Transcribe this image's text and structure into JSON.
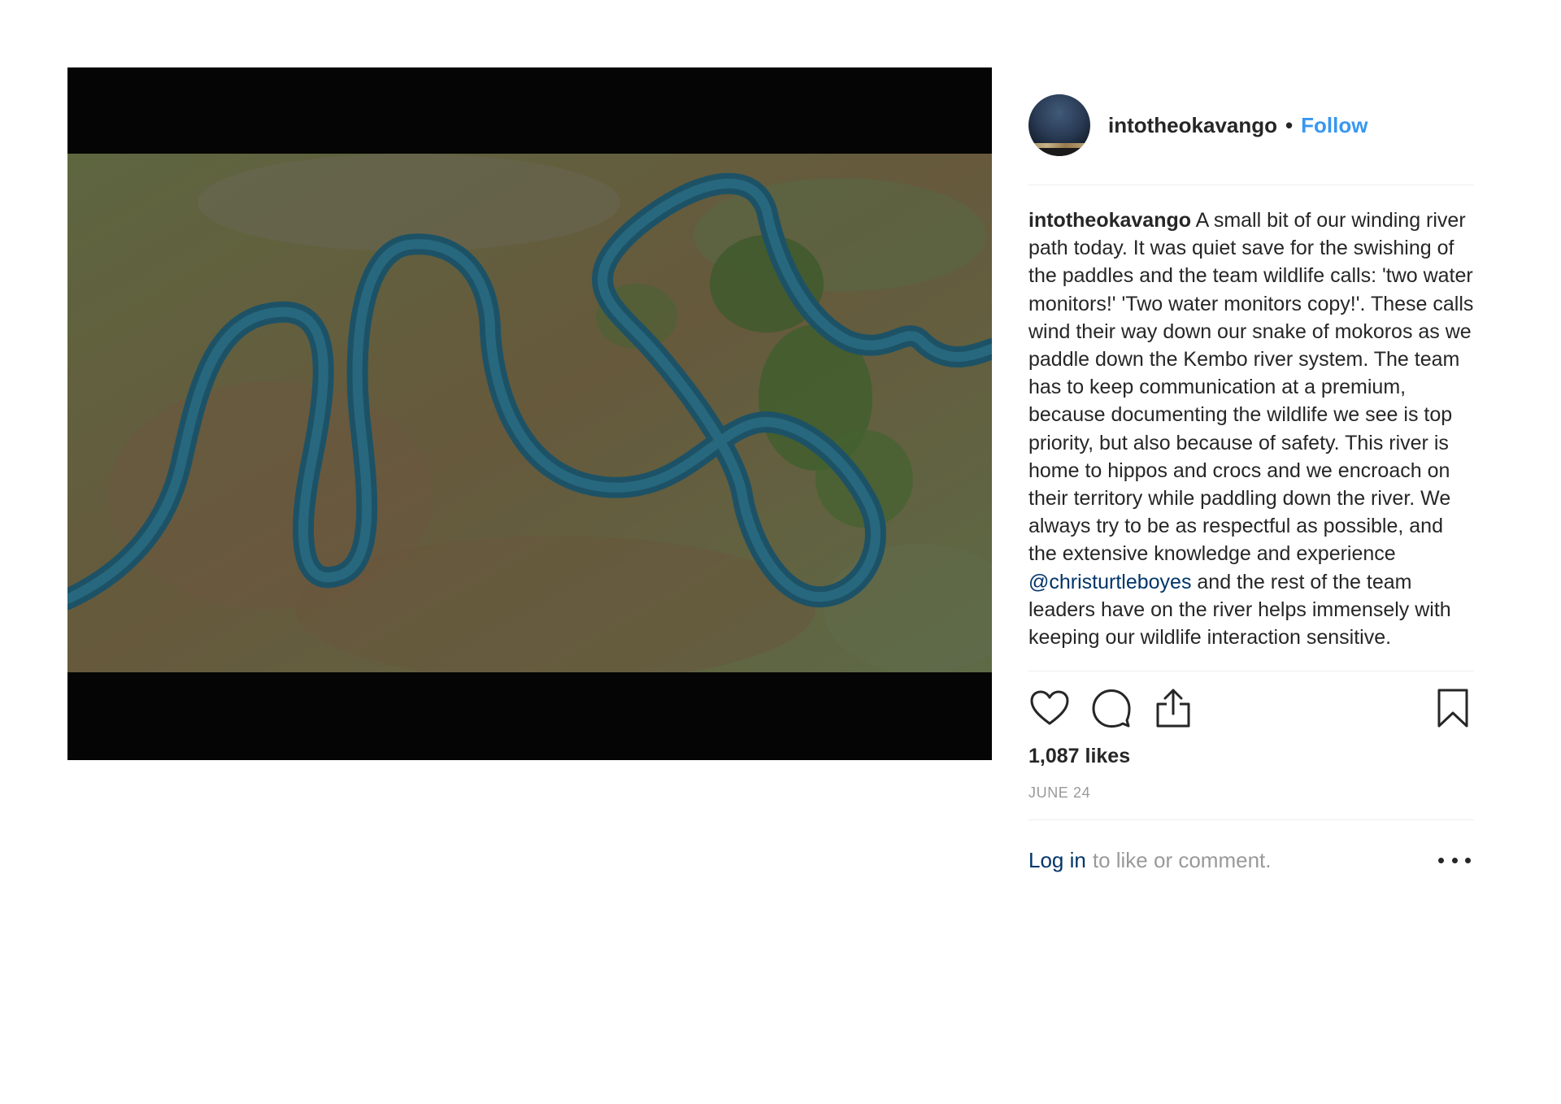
{
  "post": {
    "username": "intotheokavango",
    "follow_label": "Follow",
    "separator": "•",
    "caption": {
      "username": "intotheokavango",
      "text_before_mention": " A small bit of our winding river path today. It was quiet save for the swishing of the paddles and the team wildlife calls: 'two water monitors!' 'Two water monitors copy!'. These calls wind their way down our snake of mokoros as we paddle down the Kembo river system. The team has to keep communication at a premium, because documenting the wildlife we see is top priority, but also because of safety. This river is home to hippos and crocs and we encroach on their territory while paddling down the river. We always try to be as respectful as possible, and the extensive knowledge and experience ",
      "mention": "@christurtleboyes",
      "text_after_mention": " and the rest of the team leaders have on the river helps immensely with keeping our wildlife interaction sensitive."
    },
    "likes": "1,087 likes",
    "date": "JUNE 24",
    "login_link": "Log in",
    "login_rest": "to like or comment."
  },
  "icons": {
    "like": "heart-icon",
    "comment": "comment-icon",
    "share": "share-icon",
    "save": "bookmark-icon",
    "more": "more-options-icon"
  },
  "colors": {
    "follow": "#3897f0",
    "mention": "#003569",
    "muted": "#999999",
    "text": "#262626"
  }
}
